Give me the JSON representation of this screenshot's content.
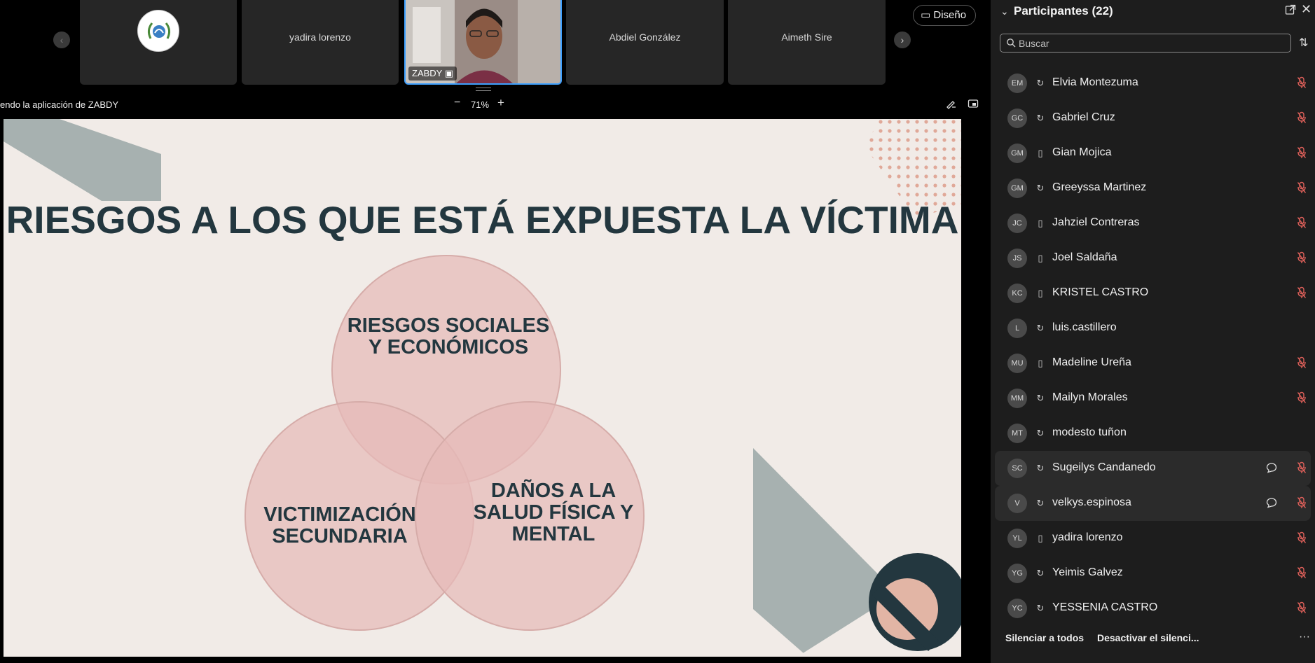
{
  "video_strip": {
    "tiles": [
      {
        "name": ""
      },
      {
        "name": "yadira lorenzo"
      },
      {
        "name": "ZABDY"
      },
      {
        "name": "Abdiel González"
      },
      {
        "name": "Aimeth Sire"
      }
    ],
    "layout_button": "Diseño"
  },
  "share_bar": {
    "text": "endo la aplicación de ZABDY",
    "zoom": "71%",
    "zoom_minus": "−",
    "zoom_plus": "+"
  },
  "slide": {
    "title": "RIESGOS A LOS QUE ESTÁ EXPUESTA LA VÍCTIMA",
    "venn": {
      "top": "RIESGOS SOCIALES Y ECONÓMICOS",
      "left": "VICTIMIZACIÓN SECUNDARIA",
      "right": "DAÑOS A LA SALUD FÍSICA Y MENTAL"
    },
    "colors": {
      "background": "#f1ebe7",
      "title": "#23373f",
      "circle": "#e9c4c2",
      "accent_gray": "#a7b1b0"
    }
  },
  "participants": {
    "title": "Participantes (22)",
    "search_placeholder": "Buscar",
    "items": [
      {
        "initials": "EM",
        "name": "Elvia Montezuma",
        "device": "sync-icon",
        "muted": true,
        "chat": false
      },
      {
        "initials": "GC",
        "name": "Gabriel Cruz",
        "device": "sync-icon",
        "muted": true,
        "chat": false
      },
      {
        "initials": "GM",
        "name": "Gian Mojica",
        "device": "phone-icon",
        "muted": true,
        "chat": false
      },
      {
        "initials": "GM",
        "name": "Greeyssa Martinez",
        "device": "sync-icon",
        "muted": true,
        "chat": false
      },
      {
        "initials": "JC",
        "name": "Jahziel Contreras",
        "device": "phone-icon",
        "muted": true,
        "chat": false
      },
      {
        "initials": "JS",
        "name": "Joel Saldaña",
        "device": "phone-icon",
        "muted": true,
        "chat": false
      },
      {
        "initials": "KC",
        "name": "KRISTEL CASTRO",
        "device": "phone-icon",
        "muted": true,
        "chat": false
      },
      {
        "initials": "L",
        "name": "luis.castillero",
        "device": "sync-icon",
        "muted": false,
        "chat": false
      },
      {
        "initials": "MU",
        "name": "Madeline Ureña",
        "device": "phone-icon",
        "muted": true,
        "chat": false
      },
      {
        "initials": "MM",
        "name": "Mailyn Morales",
        "device": "sync-icon",
        "muted": true,
        "chat": false
      },
      {
        "initials": "MT",
        "name": "modesto tuñon",
        "device": "sync-icon",
        "muted": false,
        "chat": false
      },
      {
        "initials": "SC",
        "name": "Sugeilys Candanedo",
        "device": "sync-icon",
        "muted": true,
        "chat": true
      },
      {
        "initials": "V",
        "name": "velkys.espinosa",
        "device": "sync-icon",
        "muted": true,
        "chat": true
      },
      {
        "initials": "YL",
        "name": "yadira lorenzo",
        "device": "phone-icon",
        "muted": true,
        "chat": false
      },
      {
        "initials": "YG",
        "name": "Yeimis Galvez",
        "device": "sync-icon",
        "muted": true,
        "chat": false
      },
      {
        "initials": "YC",
        "name": "YESSENIA CASTRO",
        "device": "sync-icon",
        "muted": true,
        "chat": false
      }
    ],
    "mute_all": "Silenciar a todos",
    "unmute_all": "Desactivar el silenci...",
    "more": "···"
  }
}
